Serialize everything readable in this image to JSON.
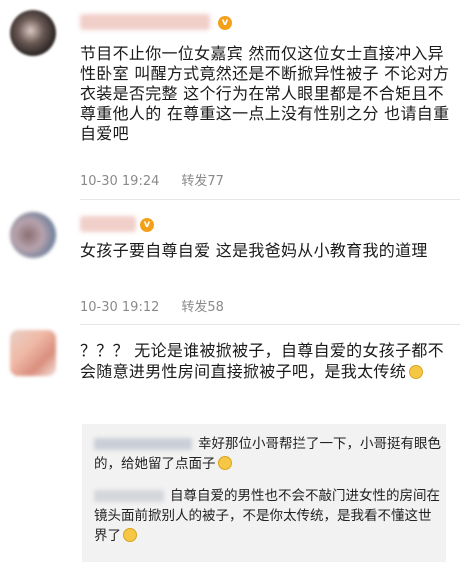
{
  "comments": [
    {
      "text": "节目不止你一位女嘉宾 然而仅这位女士直接冲入异性卧室 叫醒方式竟然还是不断掀异性被子 不论对方衣装是否完整 这个行为在常人眼里都是不合矩且不尊重他人的 在尊重这一点上没有性别之分 也请自重自爱吧",
      "time": "10-30 19:24",
      "repost": "转发77"
    },
    {
      "text": "女孩子要自尊自爱 这是我爸妈从小教育我的道理",
      "time": "10-30 19:12",
      "repost": "转发58"
    },
    {
      "text": "？？？ 无论是谁被掀被子，自尊自爱的女孩子都不会随意进男性房间直接掀被子吧，是我太传统"
    }
  ],
  "replies": [
    {
      "text": "幸好那位小哥帮拦了一下，小哥挺有眼色的，给她留了点面子"
    },
    {
      "text": "自尊自爱的男性也不会不敲门进女性的房间在镜头面前掀别人的被子，不是你太传统，是我看不懂这世界了"
    }
  ],
  "icons": [
    "v-badge-icon",
    "grin-emoji-icon",
    "sweat-emoji-icon"
  ]
}
